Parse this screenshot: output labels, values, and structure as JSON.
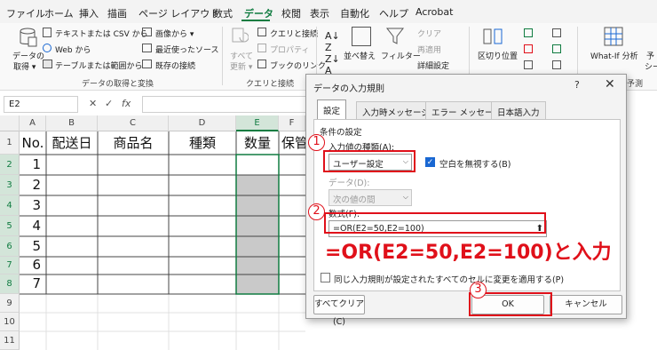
{
  "menu": {
    "items": [
      "ファイル",
      "ホーム",
      "挿入",
      "描画",
      "ページ レイアウト",
      "数式",
      "データ",
      "校閲",
      "表示",
      "自動化",
      "ヘルプ",
      "Acrobat"
    ],
    "active": "データ"
  },
  "ribbon": {
    "get_data_1": "データの",
    "get_data_2": "取得 ▾",
    "from_text_csv": "テキストまたは CSV から",
    "from_web": "Web から",
    "from_table": "テーブルまたは範囲から",
    "images": "画像から ▾",
    "recent_sources": "最近使ったソース",
    "existing_connections": "既存の接続",
    "group_get_transform": "データの取得と変換",
    "refresh_1": "すべて",
    "refresh_2": "更新 ▾",
    "queries_connections": "クエリと接続",
    "properties": "プロパティ",
    "workbook_links": "ブックのリンク",
    "group_queries": "クエリと接続",
    "sort": "並べ替え",
    "filter": "フィルター",
    "clear": "クリア",
    "reapply": "再適用",
    "advanced": "詳細設定",
    "text_to_columns": "区切り位置",
    "whatif": "What-If 分析",
    "forecast_short": "予",
    "forecast_short2": "シー",
    "group_forecast": "予測"
  },
  "formula_bar": {
    "name_box": "E2",
    "fx": "fx"
  },
  "sheet": {
    "columns": [
      "A",
      "B",
      "C",
      "D",
      "E",
      "F"
    ],
    "rows": [
      "1",
      "2",
      "3",
      "4",
      "5",
      "6",
      "7",
      "8",
      "9",
      "10",
      "11"
    ],
    "header_row": [
      "No.",
      "配送日",
      "商品名",
      "種類",
      "数量",
      "保管"
    ],
    "numbers": [
      "1",
      "2",
      "3",
      "4",
      "5",
      "6",
      "7"
    ]
  },
  "dialog": {
    "title": "データの入力規則",
    "help": "?",
    "close": "✕",
    "tabs": [
      "設定",
      "入力時メッセージ",
      "エラー メッセージ",
      "日本語入力"
    ],
    "section_conditions": "条件の設定",
    "allow_label": "入力値の種類(A):",
    "allow_value": "ユーザー設定",
    "ignore_blank": "空白を無視する(B)",
    "data_label": "データ(D):",
    "data_value": "次の値の間",
    "formula_label": "数式(F):",
    "formula_value": "=OR(E2=50,E2=100)",
    "apply_all": "同じ入力規則が設定されたすべてのセルに変更を適用する(P)",
    "clear_all": "すべてクリア(C)",
    "ok": "OK",
    "cancel": "キャンセル"
  },
  "annotations": {
    "step1": "1",
    "step2": "2",
    "step3": "3",
    "callout": "=OR(E2=50,E2=100)と入力"
  },
  "colors": {
    "accent": "#107c41",
    "red": "#e0101a",
    "gray_fill": "#c9c9c9"
  }
}
